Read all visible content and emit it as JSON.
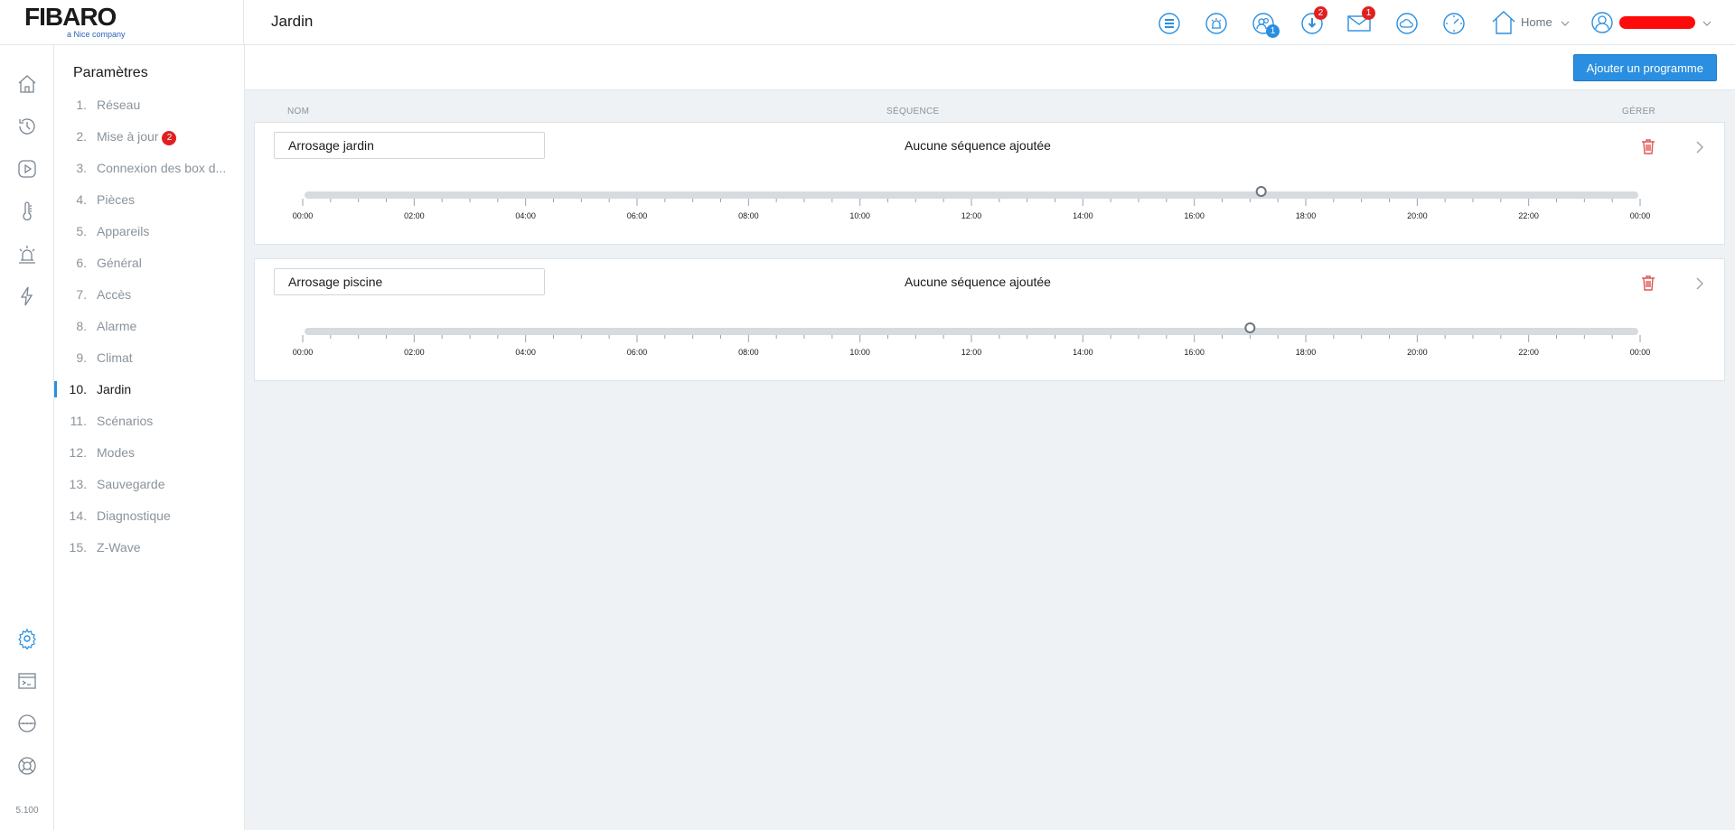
{
  "brand": {
    "name": "FIBARO",
    "tagline": "a Nice company"
  },
  "header": {
    "title": "Jardin",
    "icons": [
      {
        "name": "panels-icon"
      },
      {
        "name": "alarm-icon"
      },
      {
        "name": "users-icon",
        "badge": "1",
        "badge_color": "#2a8fe0"
      },
      {
        "name": "download-icon",
        "badge": "2",
        "badge_color": "#e02020"
      },
      {
        "name": "mail-icon",
        "badge": "1",
        "badge_color": "#e02020"
      },
      {
        "name": "weather-icon"
      },
      {
        "name": "clock-icon"
      }
    ],
    "home_label": "Home"
  },
  "rail": {
    "version": "5.100",
    "top_icons": [
      "home-icon",
      "history-icon",
      "play-icon",
      "thermometer-icon",
      "alarm-siren-icon",
      "energy-icon"
    ],
    "bottom_icons": [
      "settings-icon",
      "terminal-icon",
      "network-icon",
      "support-icon"
    ]
  },
  "nav": {
    "title": "Paramètres",
    "items": [
      {
        "num": "1.",
        "label": "Réseau"
      },
      {
        "num": "2.",
        "label": "Mise à jour",
        "badge": "2"
      },
      {
        "num": "3.",
        "label": "Connexion des box d..."
      },
      {
        "num": "4.",
        "label": "Pièces"
      },
      {
        "num": "5.",
        "label": "Appareils"
      },
      {
        "num": "6.",
        "label": "Général"
      },
      {
        "num": "7.",
        "label": "Accès"
      },
      {
        "num": "8.",
        "label": "Alarme"
      },
      {
        "num": "9.",
        "label": "Climat"
      },
      {
        "num": "10.",
        "label": "Jardin",
        "active": true
      },
      {
        "num": "11.",
        "label": "Scénarios"
      },
      {
        "num": "12.",
        "label": "Modes"
      },
      {
        "num": "13.",
        "label": "Sauvegarde"
      },
      {
        "num": "14.",
        "label": "Diagnostique"
      },
      {
        "num": "15.",
        "label": "Z-Wave"
      }
    ]
  },
  "toolbar": {
    "add_label": "Ajouter un programme"
  },
  "columns": {
    "name": "NOM",
    "sequence": "SÉQUENCE",
    "manage": "GÉRER"
  },
  "programs": [
    {
      "name": "Arrosage jardin",
      "sequence": "Aucune séquence ajoutée",
      "marker_hour": 17.2
    },
    {
      "name": "Arrosage piscine",
      "sequence": "Aucune séquence ajoutée",
      "marker_hour": 17.0
    }
  ],
  "timeline_labels": [
    "00:00",
    "02:00",
    "04:00",
    "06:00",
    "08:00",
    "10:00",
    "12:00",
    "14:00",
    "16:00",
    "18:00",
    "20:00",
    "22:00",
    "00:00"
  ],
  "colors": {
    "accent": "#2a8fe0",
    "danger": "#e05555",
    "badge_red": "#e02020"
  }
}
